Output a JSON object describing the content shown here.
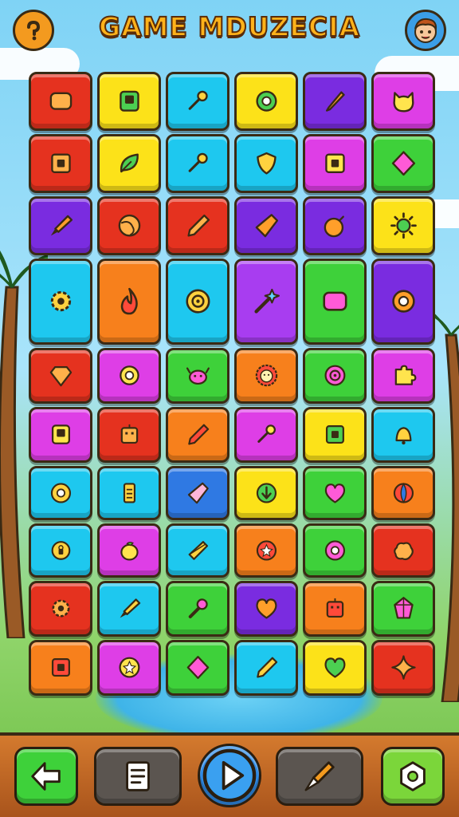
{
  "header": {
    "title": "GAME MDUZECIA",
    "help_icon": "help-icon",
    "avatar_icon": "player-avatar"
  },
  "colors": {
    "red": "#e5321f",
    "yellow": "#fce219",
    "cyan": "#1ec8ef",
    "purple": "#7a2ce0",
    "magenta": "#de3ee6",
    "orange": "#f7801c",
    "green": "#3ed13a",
    "violet": "#a83df0",
    "blue": "#2f79e3",
    "icon_dark": "#3a2a14"
  },
  "board": {
    "rows": [
      [
        [
          "red",
          "pillow"
        ],
        [
          "yellow",
          "phone"
        ],
        [
          "cyan",
          "key"
        ],
        [
          "yellow",
          "ring"
        ],
        [
          "purple",
          "pen"
        ],
        [
          "magenta",
          "cat"
        ]
      ],
      [
        [
          "red",
          "frame"
        ],
        [
          "yellow",
          "leaf"
        ],
        [
          "cyan",
          "key"
        ],
        [
          "cyan",
          "shield"
        ],
        [
          "magenta",
          "frame"
        ],
        [
          "green",
          "diamond"
        ]
      ],
      [
        [
          "purple",
          "brush"
        ],
        [
          "red",
          "globe"
        ],
        [
          "red",
          "pencil"
        ],
        [
          "purple",
          "kite"
        ],
        [
          "purple",
          "bomb"
        ],
        [
          "yellow",
          "sun"
        ]
      ],
      [
        [
          "cyan",
          "gear"
        ],
        [
          "orange",
          "flame"
        ],
        [
          "cyan",
          "target"
        ],
        [
          "violet",
          "wand"
        ],
        [
          "green",
          "pillow"
        ],
        [
          "purple",
          "ring"
        ]
      ],
      [
        [
          "red",
          "gem"
        ],
        [
          "magenta",
          "ring"
        ],
        [
          "green",
          "crab"
        ],
        [
          "orange",
          "lion"
        ],
        [
          "green",
          "target"
        ],
        [
          "magenta",
          "puzzle"
        ]
      ],
      [
        [
          "magenta",
          "phone"
        ],
        [
          "red",
          "robot"
        ],
        [
          "orange",
          "pencil"
        ],
        [
          "magenta",
          "key"
        ],
        [
          "yellow",
          "frame"
        ],
        [
          "cyan",
          "bell"
        ]
      ],
      [
        [
          "cyan",
          "donut"
        ],
        [
          "cyan",
          "battery"
        ],
        [
          "blue",
          "kite"
        ],
        [
          "yellow",
          "arrow"
        ],
        [
          "green",
          "heart"
        ],
        [
          "orange",
          "moon"
        ]
      ],
      [
        [
          "cyan",
          "lock"
        ],
        [
          "magenta",
          "berry"
        ],
        [
          "cyan",
          "envelope"
        ],
        [
          "orange",
          "star"
        ],
        [
          "green",
          "donut"
        ],
        [
          "red",
          "blob"
        ]
      ],
      [
        [
          "red",
          "gear"
        ],
        [
          "cyan",
          "brush"
        ],
        [
          "green",
          "wrench"
        ],
        [
          "purple",
          "heart"
        ],
        [
          "orange",
          "robot"
        ],
        [
          "green",
          "crystal"
        ]
      ],
      [
        [
          "orange",
          "frame"
        ],
        [
          "magenta",
          "star"
        ],
        [
          "green",
          "diamond"
        ],
        [
          "cyan",
          "pencil"
        ],
        [
          "yellow",
          "heart"
        ],
        [
          "red",
          "sparkle"
        ]
      ]
    ]
  },
  "bottom_bar": {
    "buttons": [
      {
        "name": "back-button",
        "icon": "arrow-left-icon",
        "color": "#3ed13a"
      },
      {
        "name": "menu-button",
        "icon": "list-icon",
        "color": "#5b5550"
      },
      {
        "name": "play-button",
        "icon": "play-icon",
        "color": "#2f8be6"
      },
      {
        "name": "brush-button",
        "icon": "brush-icon",
        "color": "#5b5550"
      },
      {
        "name": "settings-button",
        "icon": "settings-icon",
        "color": "#7bd63a"
      }
    ]
  }
}
